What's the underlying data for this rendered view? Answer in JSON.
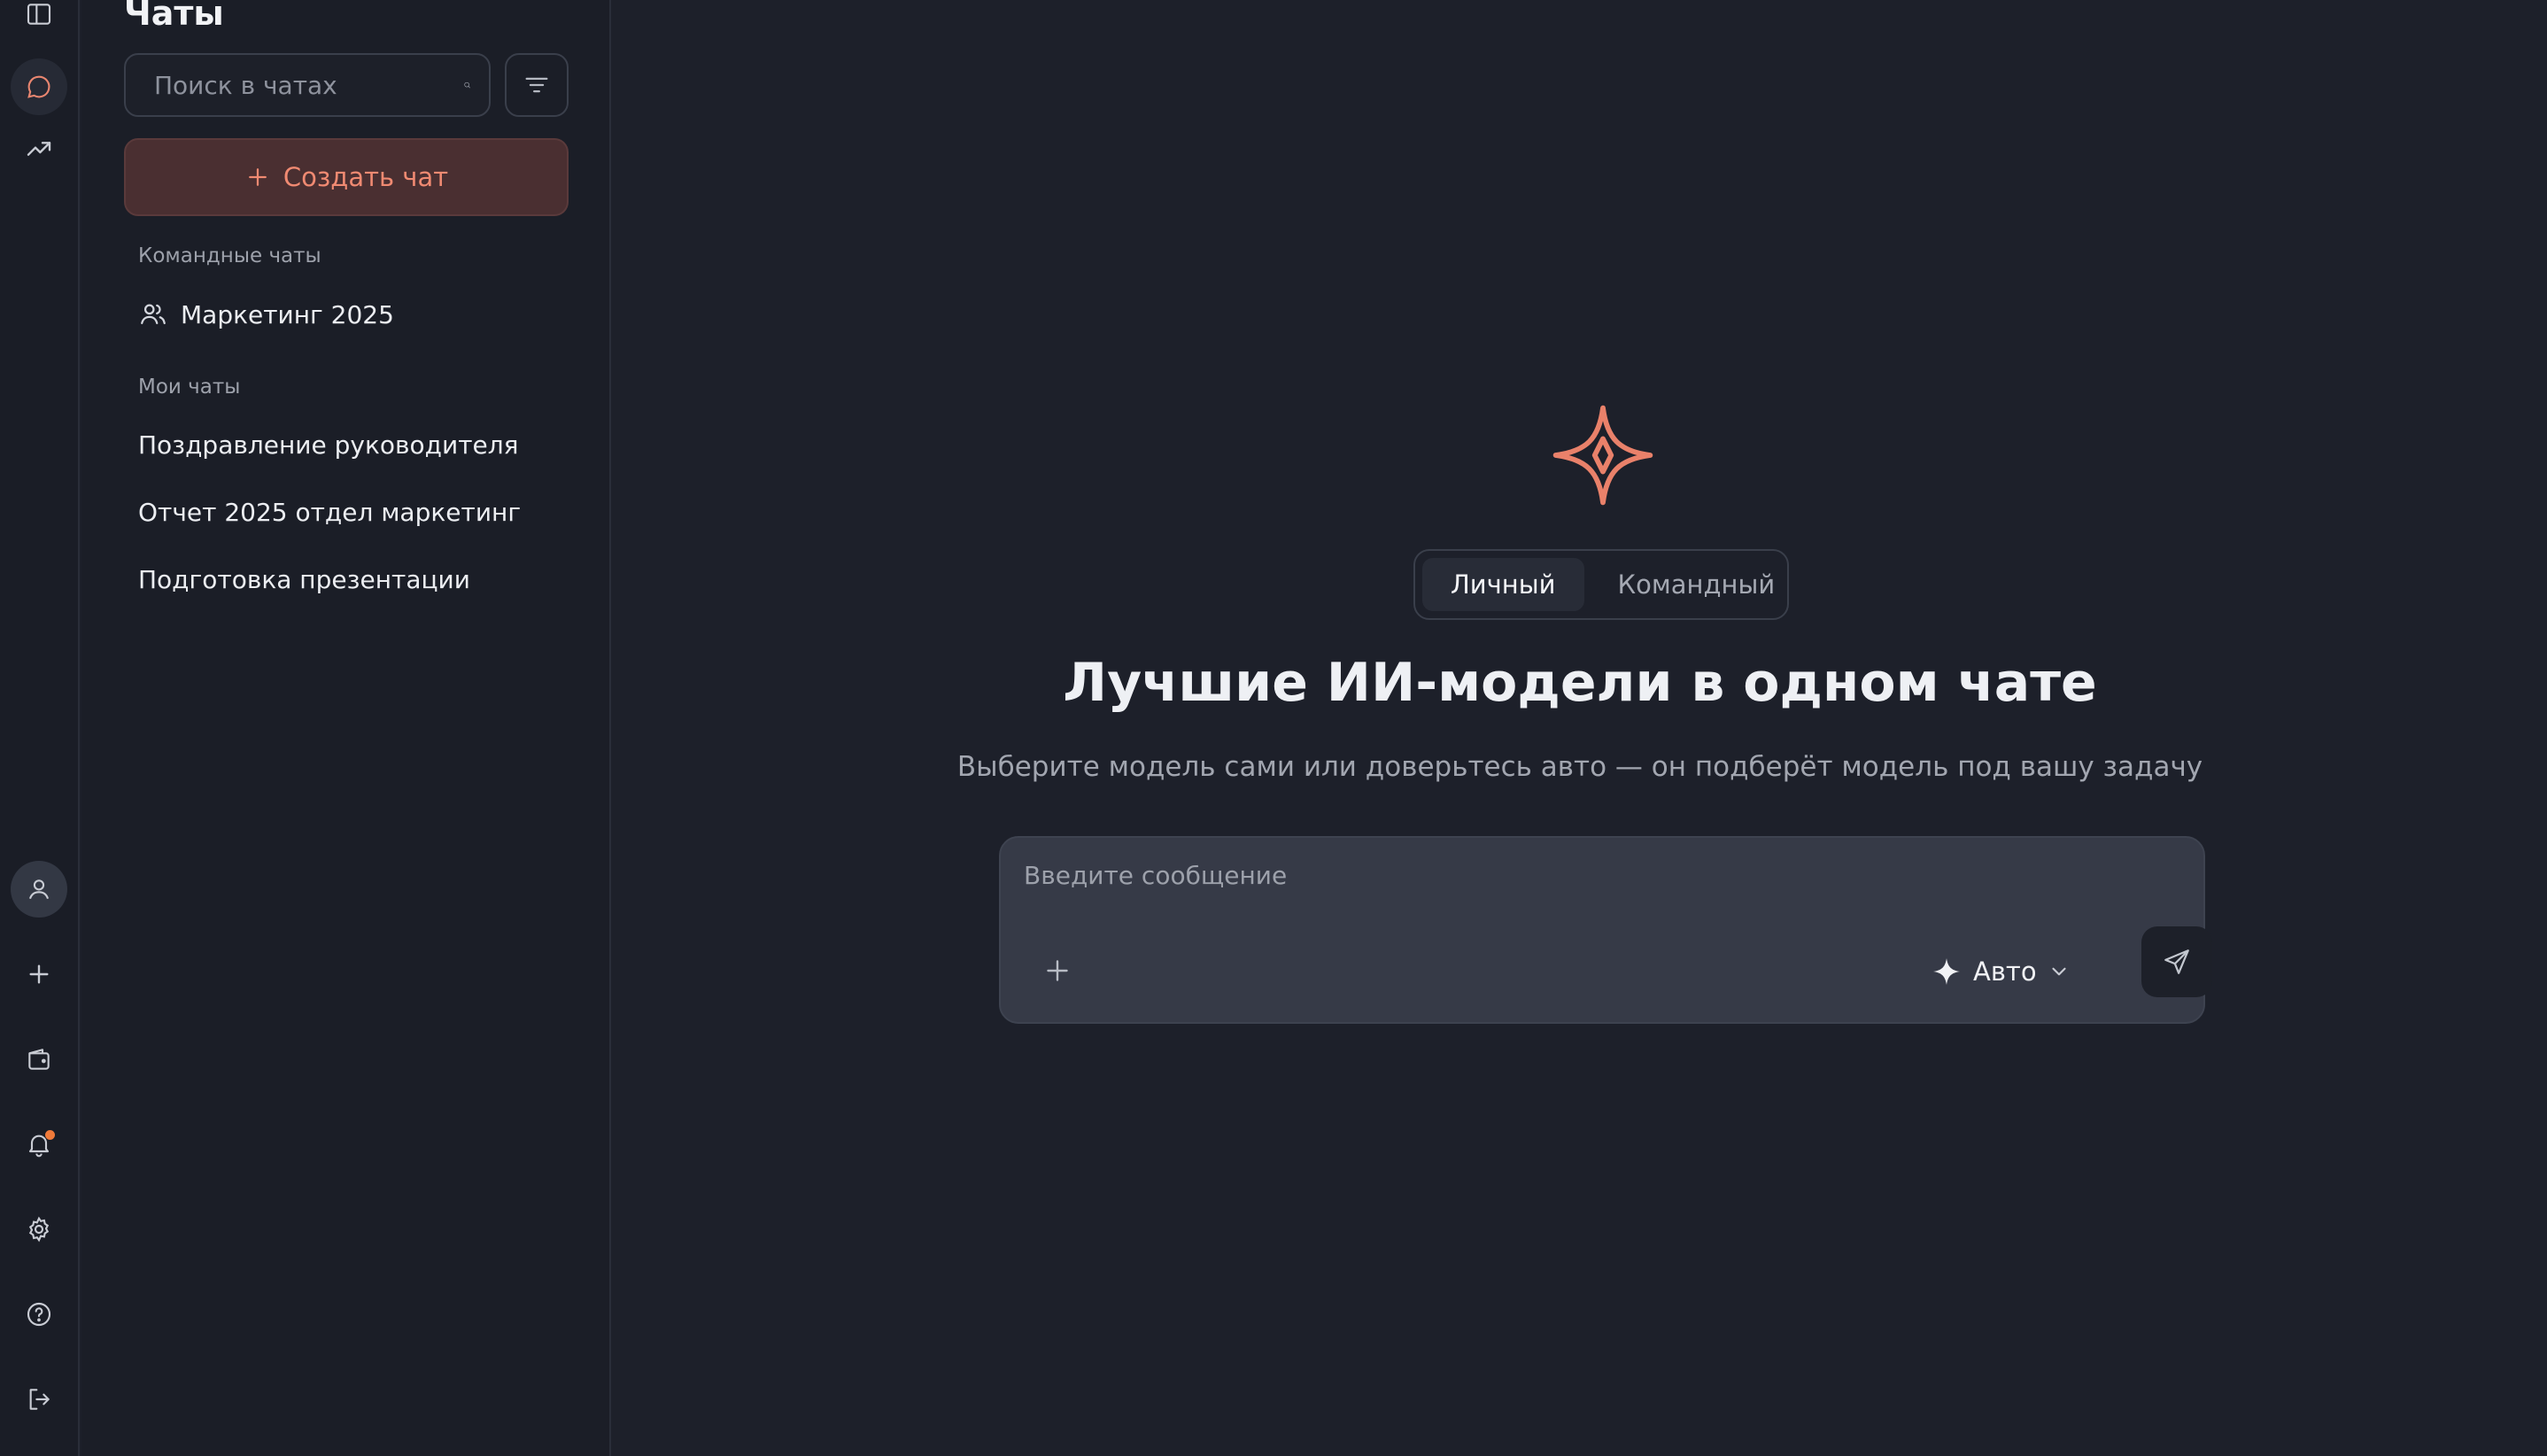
{
  "rail": {
    "icons": [
      "panel-toggle-icon",
      "chat-icon",
      "trending-up-icon",
      "user-icon",
      "plus-icon",
      "wallet-icon",
      "bell-icon",
      "gear-icon",
      "help-icon",
      "logout-icon"
    ],
    "accent": "#e98670",
    "notification_dot_color": "#f07a3a"
  },
  "sidebar": {
    "title": "Чаты",
    "search_placeholder": "Поиск в чатах",
    "create_label": "Создать чат",
    "team_section_label": "Командные чаты",
    "team_chats": [
      {
        "label": "Маркетинг 2025"
      }
    ],
    "my_section_label": "Мои чаты",
    "my_chats": [
      {
        "label": "Поздравление руководителя"
      },
      {
        "label": "Отчет 2025 отдел маркетинг"
      },
      {
        "label": "Подготовка презентации"
      }
    ]
  },
  "main": {
    "modes": [
      {
        "label": "Личный",
        "active": true
      },
      {
        "label": "Командный",
        "active": false
      }
    ],
    "headline": "Лучшие ИИ-модели в одном чате",
    "subline": "Выберите модель сами или доверьтесь авто — он подберёт модель под вашу задачу",
    "composer": {
      "placeholder": "Введите сообщение",
      "value": "",
      "model_label": "Авто"
    }
  }
}
